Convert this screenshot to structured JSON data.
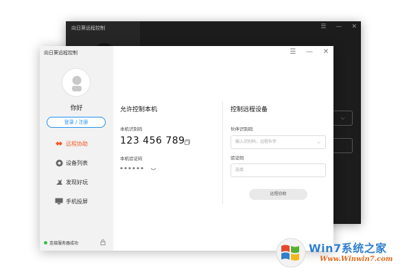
{
  "back_window": {
    "title": "向日葵远程控制",
    "controls": [
      "☰",
      "—",
      "✕"
    ],
    "select_chevron": "⌵"
  },
  "window": {
    "title": "向日葵远程控制",
    "controls": [
      "☰",
      "—",
      "✕"
    ]
  },
  "sidebar": {
    "nickname": "你好",
    "login_label": "登录 / 注册",
    "items": [
      {
        "label": "远程协助",
        "icon": "handshake-icon",
        "active": true
      },
      {
        "label": "设备列表",
        "icon": "device-list-icon",
        "active": false
      },
      {
        "label": "发现好玩",
        "icon": "discover-icon",
        "active": false
      },
      {
        "label": "手机投屏",
        "icon": "screen-cast-icon",
        "active": false
      }
    ],
    "status_text": "连接服务器成功",
    "status_color": "#36c23a"
  },
  "allow_panel": {
    "title": "允许控制本机",
    "id_label": "本机识别码",
    "id_value": "123 456 789",
    "code_label": "本机验证码",
    "code_value": "******"
  },
  "control_panel": {
    "title": "控制远程设备",
    "partner_label": "伙伴识别码",
    "partner_placeholder": "输入识别码，远程伙伴",
    "code_label": "验证码",
    "code_placeholder": "选填",
    "connect_label": "远程协助"
  },
  "watermark": {
    "brand": "Win7系统之家",
    "url": "Www.Winwin7.com"
  },
  "colors": {
    "accent": "#f05a28",
    "link": "#1e8ff0"
  }
}
